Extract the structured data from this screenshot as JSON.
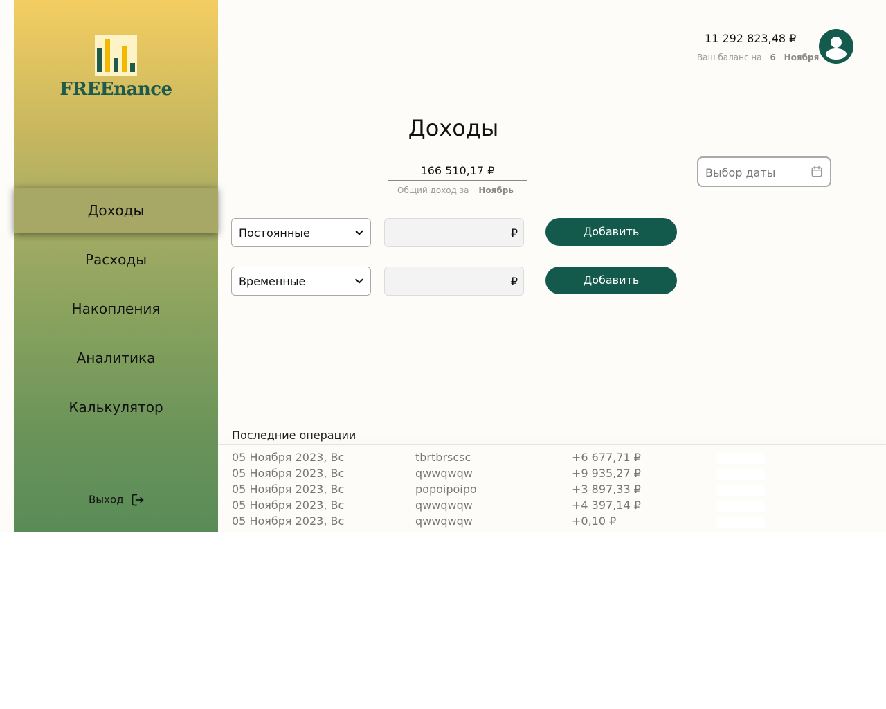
{
  "brand": {
    "name": "FREEnance",
    "logo_icon": "bar-chart-icon"
  },
  "sidebar": {
    "items": [
      {
        "label": "Доходы",
        "active": true
      },
      {
        "label": "Расходы",
        "active": false
      },
      {
        "label": "Накопления",
        "active": false
      },
      {
        "label": "Аналитика",
        "active": false
      },
      {
        "label": "Калькулятор",
        "active": false
      }
    ],
    "logout_label": "Выход",
    "logout_icon": "logout-icon"
  },
  "header": {
    "balance_value": "11 292 823,48 ₽",
    "balance_caption": "Ваш баланс на",
    "balance_day": "6",
    "balance_month": "Ноября",
    "avatar_icon": "user-avatar-icon"
  },
  "main": {
    "title": "Доходы",
    "income_total": "166 510,17 ₽",
    "income_caption": "Общий доход за",
    "income_month": "Ноябрь",
    "date_picker_placeholder": "Выбор даты",
    "forms": [
      {
        "type_label": "Постоянные",
        "currency": "₽",
        "amount": "",
        "button_label": "Добавить"
      },
      {
        "type_label": "Временные",
        "currency": "₽",
        "amount": "",
        "button_label": "Добавить"
      }
    ]
  },
  "operations": {
    "title": "Последние операции",
    "rows": [
      {
        "date": "05 Ноября 2023, Вс",
        "name": "tbrtbrscsc",
        "amount": "+6 677,71 ₽"
      },
      {
        "date": "05 Ноября 2023, Вс",
        "name": "qwwqwqw",
        "amount": "+9 935,27 ₽"
      },
      {
        "date": "05 Ноября 2023, Вс",
        "name": "popoipoipo",
        "amount": "+3 897,33 ₽"
      },
      {
        "date": "05 Ноября 2023, Вс",
        "name": "qwwqwqw",
        "amount": "+4 397,14 ₽"
      },
      {
        "date": "05 Ноября 2023, Вс",
        "name": "qwwqwqw",
        "amount": "+0,10 ₽"
      }
    ]
  },
  "colors": {
    "accent": "#135a4d",
    "sidebar_top": "#f4cd62",
    "sidebar_bottom": "#5a8c58",
    "logo_dark_bar": "#1f5b4c",
    "logo_light_bar": "#f0b800"
  }
}
